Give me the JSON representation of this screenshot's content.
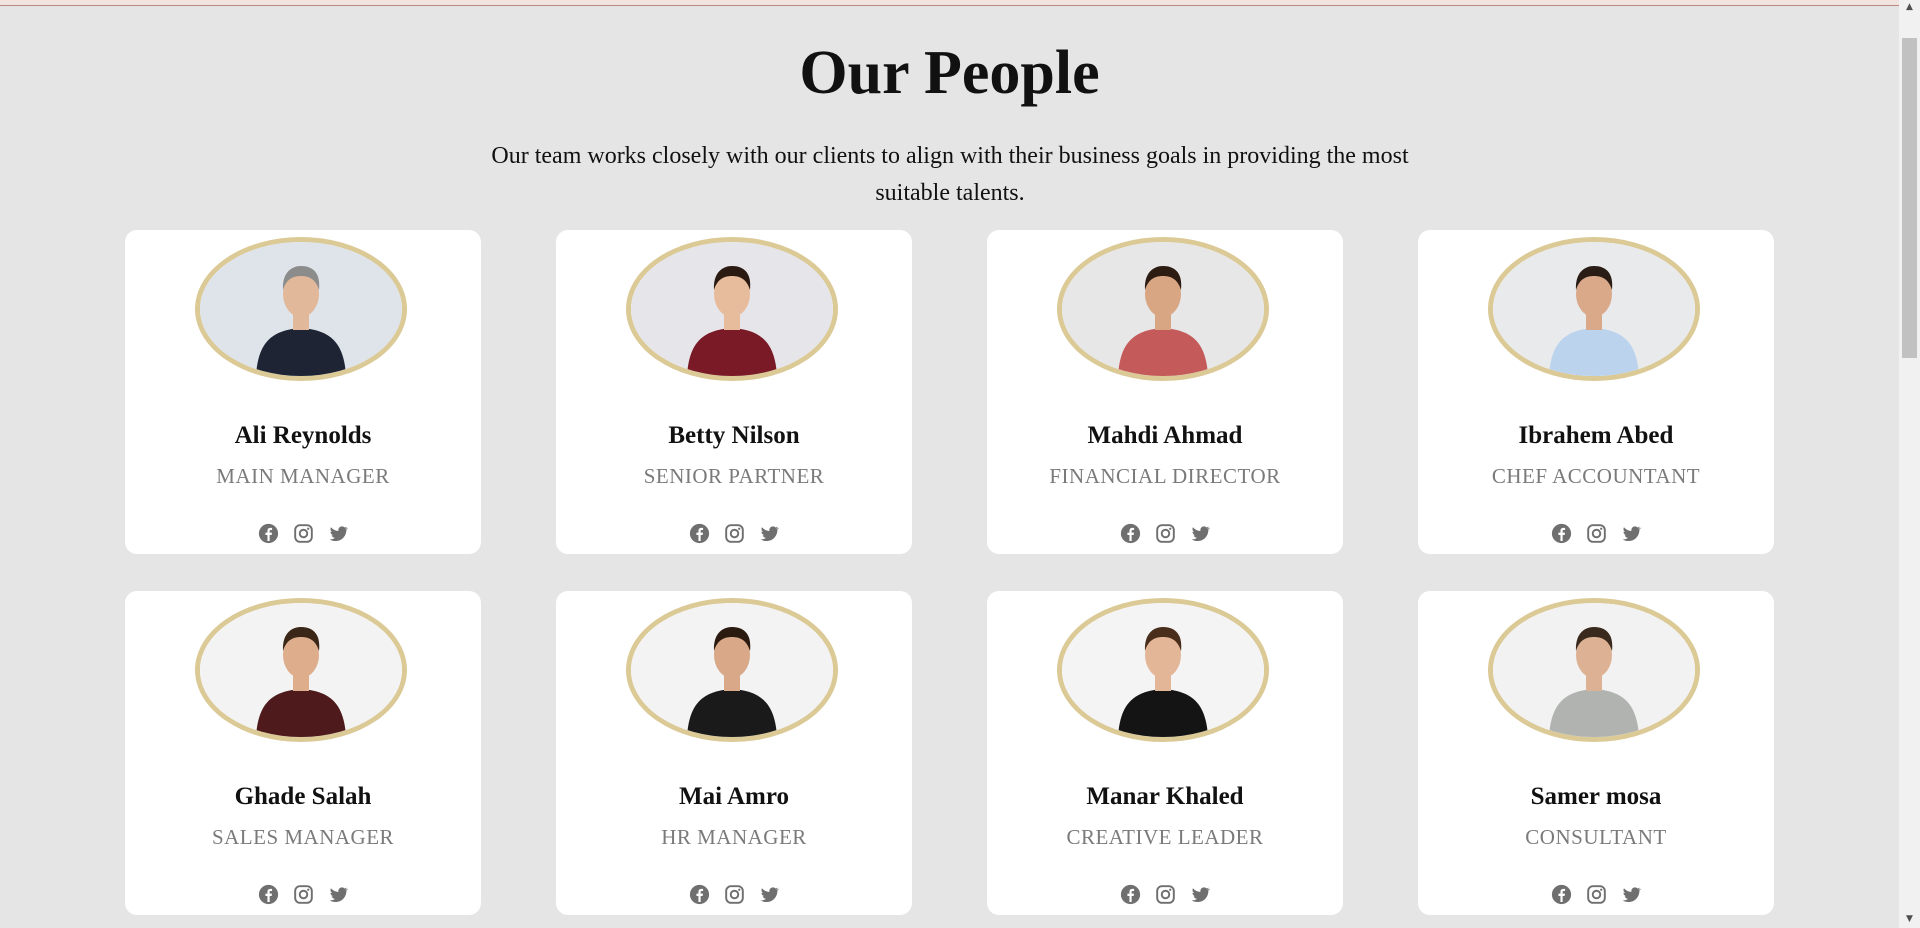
{
  "page": {
    "title": "Our People",
    "subtitle": "Our team works closely with our clients to align with their business goals in providing the most suitable talents."
  },
  "colors": {
    "background": "#e5e5e5",
    "card": "#ffffff",
    "photo_border": "#dbc996",
    "role_text": "#7a7a7a",
    "icon": "#6f6f6f"
  },
  "team": [
    {
      "name": "Ali Reynolds",
      "role": "MAIN MANAGER",
      "shirt": "#1e2433",
      "skin": "#e2b89a",
      "hair": "#8c8c8c",
      "bg": "#dfe4ea"
    },
    {
      "name": "Betty Nilson",
      "role": "SENIOR PARTNER",
      "shirt": "#7a1a26",
      "skin": "#e7bc9c",
      "hair": "#2a1a12",
      "bg": "#e6e6ea"
    },
    {
      "name": "Mahdi Ahmad",
      "role": "FINANCIAL DIRECTOR",
      "shirt": "#c45a5a",
      "skin": "#d9a684",
      "hair": "#2c1c12",
      "bg": "#e7e7e7"
    },
    {
      "name": "Ibrahem Abed",
      "role": "CHEF ACCOUNTANT",
      "shirt": "#bcd3ee",
      "skin": "#d9a98a",
      "hair": "#2a1d15",
      "bg": "#e9eaec"
    },
    {
      "name": "Ghade Salah",
      "role": "SALES MANAGER",
      "shirt": "#4e1a1c",
      "skin": "#ddad8c",
      "hair": "#3a2718",
      "bg": "#f3f3f3"
    },
    {
      "name": "Mai Amro",
      "role": "HR MANAGER",
      "shirt": "#1a1a1a",
      "skin": "#d8a888",
      "hair": "#2b1a10",
      "bg": "#f3f3f3"
    },
    {
      "name": "Manar Khaled",
      "role": "CREATIVE LEADER",
      "shirt": "#141414",
      "skin": "#e3b697",
      "hair": "#4a2e1c",
      "bg": "#f4f4f4"
    },
    {
      "name": "Samer mosa",
      "role": "CONSULTANT",
      "shirt": "#b0b3b0",
      "skin": "#ddb294",
      "hair": "#3a2a1e",
      "bg": "#f2f2f2"
    }
  ],
  "social_icons": [
    "facebook-icon",
    "instagram-icon",
    "twitter-icon"
  ]
}
